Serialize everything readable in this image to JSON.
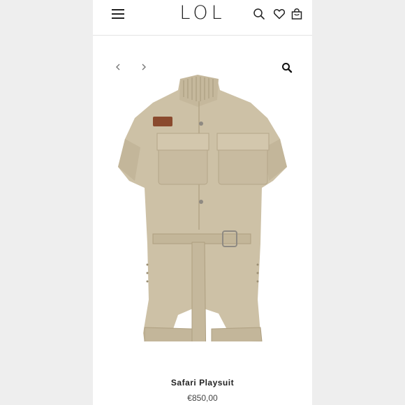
{
  "header": {
    "logo": "LOL",
    "menu_icon": "hamburger-menu-icon",
    "search_icon": "search-icon",
    "wishlist_icon": "heart-icon",
    "cart_icon": "shopping-bag-icon"
  },
  "gallery": {
    "prev_icon": "chevron-left-icon",
    "next_icon": "chevron-right-icon",
    "zoom_icon": "magnifier-zoom-icon",
    "image_color": "#cbbfa5"
  },
  "product": {
    "title": "Safari Playsuit",
    "price": "€850,00"
  }
}
